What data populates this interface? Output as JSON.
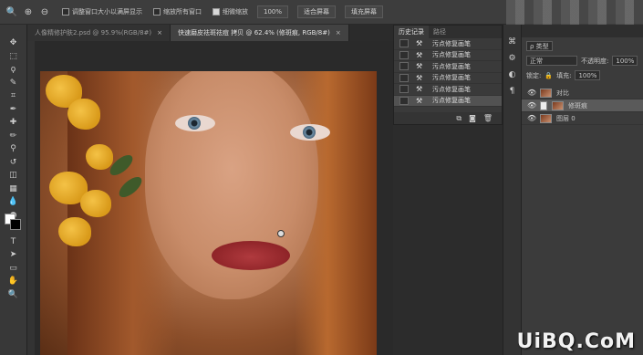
{
  "options": {
    "resize_windows": "调整窗口大小以满屏显示",
    "zoom_all": "缩放所有窗口",
    "scrubby_zoom": "细微缩放",
    "zoom_pct": "100%",
    "fit_screen": "适合屏幕",
    "fill_screen": "填充屏幕"
  },
  "tabs": [
    {
      "label": "人像精修护肤2.psd @ 95.9%(RGB/8#)",
      "close": "×"
    },
    {
      "label": "快速磨皮祛斑祛痘 拷贝 @ 62.4% (修斑痕, RGB/8#)",
      "close": "×"
    }
  ],
  "history": {
    "tab_active": "历史记录",
    "tab_other": "路径",
    "items": [
      "污点修复画笔",
      "污点修复画笔",
      "污点修复画笔",
      "污点修复画笔",
      "污点修复画笔",
      "污点修复画笔"
    ]
  },
  "layers": {
    "kind_label": "ρ 类型",
    "blend_mode": "正常",
    "opacity_label": "不透明度:",
    "opacity_value": "100%",
    "lock_label": "锁定:",
    "fill_label": "填充:",
    "fill_value": "100%",
    "items": [
      {
        "name": "对比"
      },
      {
        "name": "修斑痕"
      },
      {
        "name": "图层 0"
      }
    ]
  },
  "watermark": "UiBQ.CoM"
}
